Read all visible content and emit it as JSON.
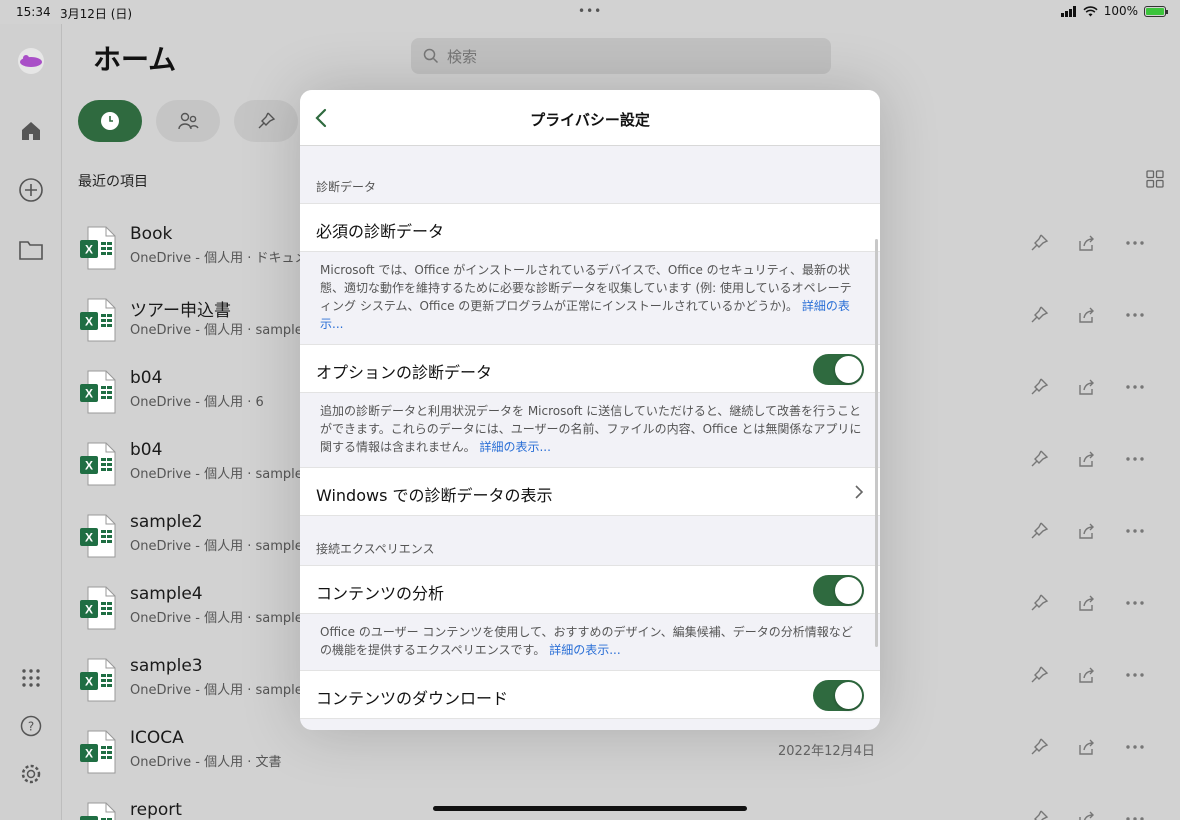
{
  "status_bar": {
    "time": "15:34",
    "date": "3月12日 (日)",
    "more": "•••",
    "battery": "100%"
  },
  "sidebar": {
    "items": [
      {
        "name": "home-icon"
      },
      {
        "name": "add-icon"
      },
      {
        "name": "folder-icon"
      },
      {
        "name": "apps-grid-icon"
      },
      {
        "name": "help-icon"
      },
      {
        "name": "settings-gear-icon"
      }
    ]
  },
  "main": {
    "title": "ホーム",
    "search_placeholder": "検索",
    "section_label": "最近の項目",
    "files": [
      {
        "name": "Book",
        "sub": "OneDrive - 個人用 · ドキュメント",
        "date": ""
      },
      {
        "name": "ツアー申込書",
        "sub": "OneDrive - 個人用 · sample",
        "date": ""
      },
      {
        "name": "b04",
        "sub": "OneDrive - 個人用 · 6",
        "date": ""
      },
      {
        "name": "b04",
        "sub": "OneDrive - 個人用 · sample",
        "date": ""
      },
      {
        "name": "sample2",
        "sub": "OneDrive - 個人用 · sample",
        "date": ""
      },
      {
        "name": "sample4",
        "sub": "OneDrive - 個人用 · sample",
        "date": ""
      },
      {
        "name": "sample3",
        "sub": "OneDrive - 個人用 · sample",
        "date": ""
      },
      {
        "name": "ICOCA",
        "sub": "OneDrive - 個人用 · 文書",
        "date": "2022年12月4日"
      },
      {
        "name": "report",
        "sub": "",
        "date": ""
      }
    ]
  },
  "modal": {
    "title": "プライバシー設定",
    "group1_label": "診断データ",
    "required_label": "必須の診断データ",
    "required_desc": "Microsoft では、Office がインストールされているデバイスで、Office のセキュリティ、最新の状態、適切な動作を維持するために必要な診断データを収集しています (例: 使用しているオペレーティング システム、Office の更新プログラムが正常にインストールされているかどうか)。",
    "required_link": "詳細の表示...",
    "optional_label": "オプションの診断データ",
    "optional_desc": "追加の診断データと利用状況データを Microsoft に送信していただけると、継続して改善を行うことができます。これらのデータには、ユーザーの名前、ファイルの内容、Office とは無関係なアプリに関する情報は含まれません。",
    "optional_link": "詳細の表示...",
    "windows_label": "Windows での診断データの表示",
    "group2_label": "接続エクスペリエンス",
    "analysis_label": "コンテンツの分析",
    "analysis_desc": "Office のユーザー コンテンツを使用して、おすすめのデザイン、編集候補、データの分析情報などの機能を提供するエクスペリエンスです。",
    "analysis_link": "詳細の表示...",
    "download_label": "コンテンツのダウンロード",
    "optional_toggle": true,
    "analysis_toggle": true,
    "download_toggle": true
  },
  "colors": {
    "accent": "#2f6a3f",
    "link": "#2a6fd6"
  }
}
